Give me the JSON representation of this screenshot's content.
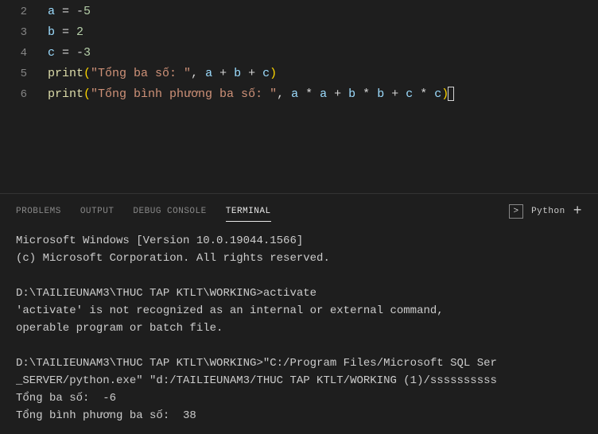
{
  "editor": {
    "lines": [
      {
        "num": "2",
        "tokens": [
          {
            "t": "a",
            "c": "var"
          },
          {
            "t": " = ",
            "c": "op"
          },
          {
            "t": "-",
            "c": "op"
          },
          {
            "t": "5",
            "c": "num"
          }
        ]
      },
      {
        "num": "3",
        "tokens": [
          {
            "t": "b",
            "c": "var"
          },
          {
            "t": " = ",
            "c": "op"
          },
          {
            "t": "2",
            "c": "num"
          }
        ]
      },
      {
        "num": "4",
        "tokens": [
          {
            "t": "c",
            "c": "var"
          },
          {
            "t": " = ",
            "c": "op"
          },
          {
            "t": "-",
            "c": "op"
          },
          {
            "t": "3",
            "c": "num"
          }
        ]
      },
      {
        "num": "5",
        "tokens": [
          {
            "t": "print",
            "c": "func"
          },
          {
            "t": "(",
            "c": "paren-yellow"
          },
          {
            "t": "\"Tổng ba số: \"",
            "c": "str"
          },
          {
            "t": ", ",
            "c": "op"
          },
          {
            "t": "a",
            "c": "var"
          },
          {
            "t": " + ",
            "c": "op"
          },
          {
            "t": "b",
            "c": "var"
          },
          {
            "t": " + ",
            "c": "op"
          },
          {
            "t": "c",
            "c": "var"
          },
          {
            "t": ")",
            "c": "paren-yellow"
          }
        ]
      },
      {
        "num": "6",
        "tokens": [
          {
            "t": "print",
            "c": "func"
          },
          {
            "t": "(",
            "c": "paren-yellow"
          },
          {
            "t": "\"Tổng bình phương ba số: \"",
            "c": "str"
          },
          {
            "t": ", ",
            "c": "op"
          },
          {
            "t": "a",
            "c": "var"
          },
          {
            "t": " * ",
            "c": "op"
          },
          {
            "t": "a",
            "c": "var"
          },
          {
            "t": " + ",
            "c": "op"
          },
          {
            "t": "b",
            "c": "var"
          },
          {
            "t": " * ",
            "c": "op"
          },
          {
            "t": "b",
            "c": "var"
          },
          {
            "t": " + ",
            "c": "op"
          },
          {
            "t": "c",
            "c": "var"
          },
          {
            "t": " * ",
            "c": "op"
          },
          {
            "t": "c",
            "c": "var"
          },
          {
            "t": ")",
            "c": "paren-yellow"
          }
        ],
        "cursor": true
      }
    ]
  },
  "panel": {
    "tabs": [
      "PROBLEMS",
      "OUTPUT",
      "DEBUG CONSOLE",
      "TERMINAL"
    ],
    "active": "TERMINAL",
    "shell": "Python"
  },
  "terminal": {
    "lines": [
      "Microsoft Windows [Version 10.0.19044.1566]",
      "(c) Microsoft Corporation. All rights reserved.",
      "",
      "D:\\TAILIEUNAM3\\THUC TAP KTLT\\WORKING>activate",
      "'activate' is not recognized as an internal or external command,",
      "operable program or batch file.",
      "",
      "D:\\TAILIEUNAM3\\THUC TAP KTLT\\WORKING>\"C:/Program Files/Microsoft SQL Ser",
      "_SERVER/python.exe\" \"d:/TAILIEUNAM3/THUC TAP KTLT/WORKING (1)/ssssssssss",
      "Tổng ba số:  -6",
      "Tổng bình phương ba số:  38"
    ]
  }
}
